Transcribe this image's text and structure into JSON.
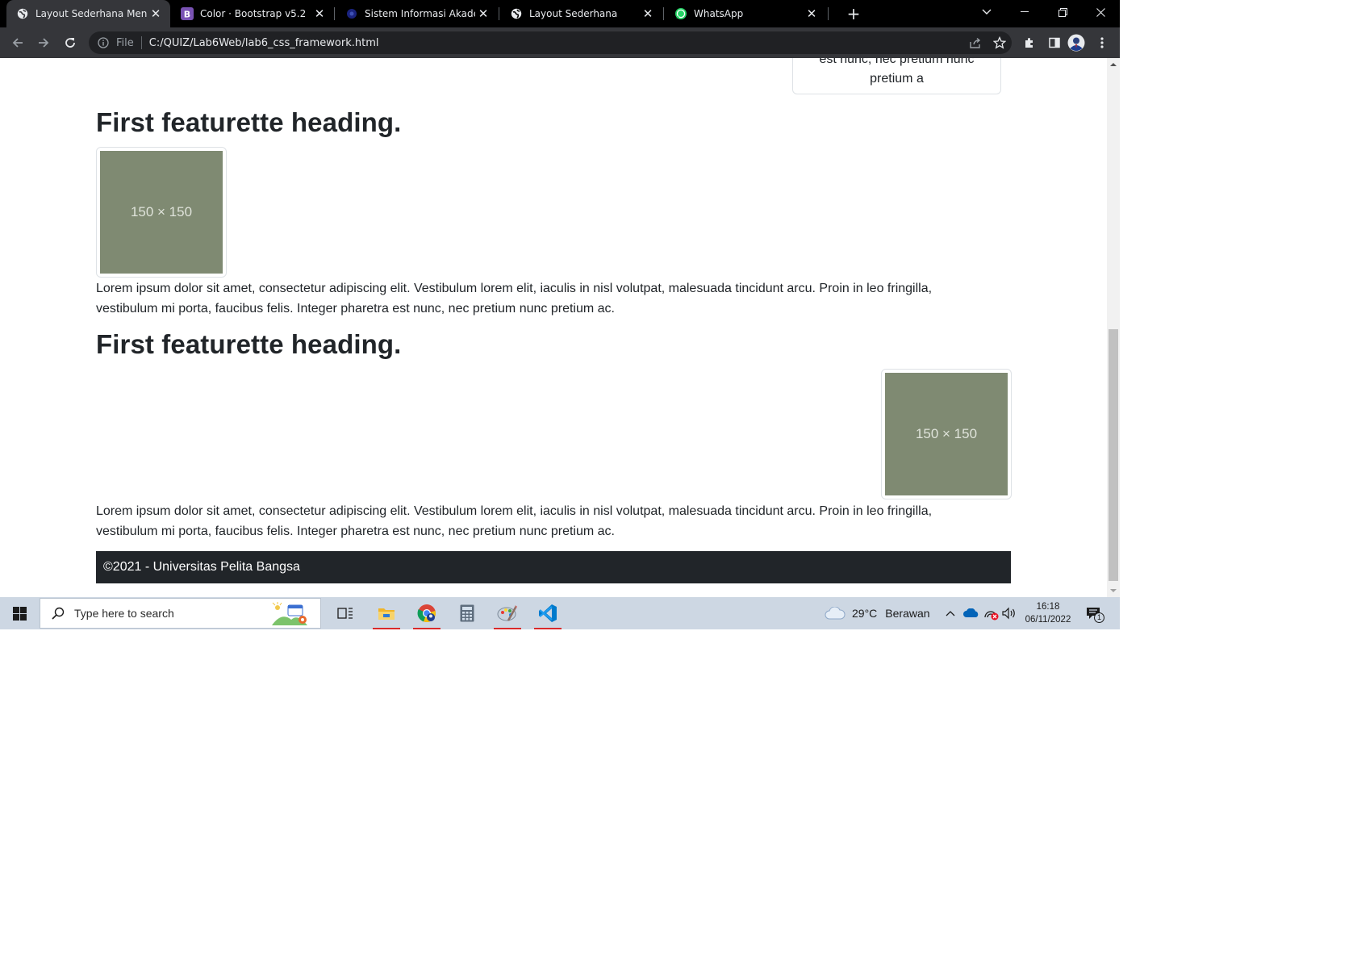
{
  "browser": {
    "tabs": [
      {
        "title": "Layout Sederhana Menggunakan",
        "icon": "globe-icon",
        "active": true
      },
      {
        "title": "Color · Bootstrap v5.2",
        "icon": "bootstrap-icon",
        "active": false
      },
      {
        "title": "Sistem Informasi Akademik",
        "icon": "academic-icon",
        "active": false
      },
      {
        "title": "Layout Sederhana",
        "icon": "globe-icon",
        "active": false
      },
      {
        "title": "WhatsApp",
        "icon": "whatsapp-icon",
        "active": false
      }
    ],
    "address": {
      "scheme_label": "File",
      "url": "C:/QUIZ/Lab6Web/lab6_css_framework.html"
    }
  },
  "page": {
    "top_card": {
      "line1": "est nunc, nec pretium nunc",
      "line2": "pretium a"
    },
    "featurettes": [
      {
        "heading": "First featurette heading.",
        "image_label": "150 × 150",
        "image_align": "left",
        "text_line1": "Lorem ipsum dolor sit amet, consectetur adipiscing elit. Vestibulum lorem elit, iaculis in nisl volutpat, malesuada tincidunt arcu. Proin in leo fringilla,",
        "text_line2": "vestibulum mi porta, faucibus felis. Integer pharetra est nunc, nec pretium nunc pretium ac."
      },
      {
        "heading": "First featurette heading.",
        "image_label": "150 × 150",
        "image_align": "right",
        "text_line1": "Lorem ipsum dolor sit amet, consectetur adipiscing elit. Vestibulum lorem elit, iaculis in nisl volutpat, malesuada tincidunt arcu. Proin in leo fringilla,",
        "text_line2": "vestibulum mi porta, faucibus felis. Integer pharetra est nunc, nec pretium nunc pretium ac."
      }
    ],
    "footer": "©2021 - Universitas Pelita Bangsa"
  },
  "taskbar": {
    "search_placeholder": "Type here to search",
    "apps": [
      {
        "name": "task-view-icon",
        "running": false
      },
      {
        "name": "file-explorer-icon",
        "running": true
      },
      {
        "name": "chrome-icon",
        "running": true
      },
      {
        "name": "calculator-icon",
        "running": false
      },
      {
        "name": "paint-icon",
        "running": true
      },
      {
        "name": "vscode-icon",
        "running": true
      }
    ],
    "weather": {
      "temp": "29°C",
      "condition": "Berawan"
    },
    "clock": {
      "time": "16:18",
      "date": "06/11/2022"
    },
    "notification_count": "1"
  },
  "colors": {
    "placeholder_fill": "#7f8a72",
    "footer_bg": "#212529",
    "taskbar_bg": "#cdd7e3",
    "running_indicator": "#d92a2a"
  }
}
